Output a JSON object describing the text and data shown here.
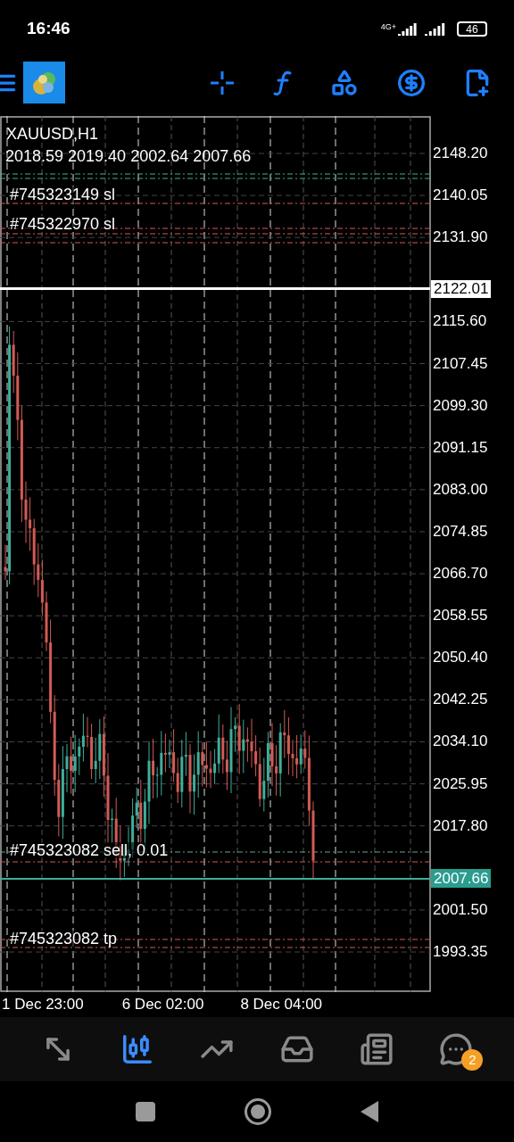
{
  "status_bar": {
    "time": "16:46",
    "network": "4G+",
    "battery": "46"
  },
  "chart": {
    "symbol": "XAUUSD,H1",
    "ohlc": "2018.59 2019.40 2002.64 2007.66",
    "order_labels": [
      "#745323149 sl",
      "#745322970 sl",
      "#745323082 sell, 0.01",
      "#745323082 tp"
    ],
    "price_labels": [
      "2148.20",
      "2140.05",
      "2131.90",
      "2115.60",
      "2107.45",
      "2099.30",
      "2091.15",
      "2083.00",
      "2074.85",
      "2066.70",
      "2058.55",
      "2050.40",
      "2042.25",
      "2034.10",
      "2025.95",
      "2017.80",
      "2001.50",
      "1993.35"
    ],
    "line_price": "2122.01",
    "current_price": "2007.66",
    "time_labels": [
      "1 Dec 23:00",
      "6 Dec 02:00",
      "8 Dec 04:00"
    ]
  },
  "bottom_nav": [
    {
      "selected": false
    },
    {
      "selected": true
    },
    {
      "selected": false
    },
    {
      "selected": false
    },
    {
      "selected": false
    },
    {
      "selected": false,
      "badge": "2"
    }
  ]
}
